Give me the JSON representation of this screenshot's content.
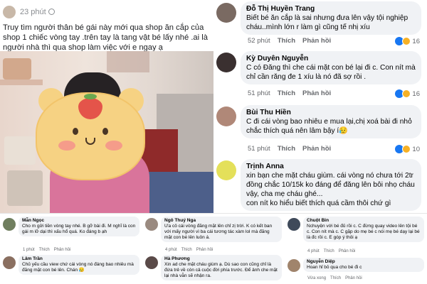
{
  "post": {
    "time": "23 phút",
    "text": "Truy tìm người thân bé gái này mới qua shop ăn cắp của shop 1 chiếc vòng tay .trên tay là tang vật bé lấy nhé .ai là người nhà thì qua shop làm việc với e ngay ạ"
  },
  "labels": {
    "like": "Thích",
    "reply": "Phản hồi"
  },
  "comments": [
    {
      "name": "Đỗ Thị Huyền Trang",
      "text": "Biết bé ăn cắp là sai nhưng đưa lên vậy tội nghiệp cháu..mình lớn r làm gì cũng tế nhị xíu",
      "time": "52 phút",
      "count": "16",
      "avatar": "#7a6a62"
    },
    {
      "name": "Kỳ Duyên Nguyễn",
      "text": "C có Đăng thì che cái mặt con bé lại đi c. Con nít mà chỉ cần răng đe 1 xíu là nó đã sợ rồi .",
      "time": "51 phút",
      "count": "16",
      "avatar": "#3a3030"
    },
    {
      "name": "Bùi Thu Hiền",
      "text": "C đi cái vòng bao nhiêu e mua lại,chị xoá bài đi nhỏ chắc thích quá nên lâm bậy í😥",
      "time": "51 phút",
      "count": "10",
      "avatar": "#b08878"
    },
    {
      "name": "Trịnh Anna",
      "text": "xin bạn che mặt cháu giùm. cái vòng nó chưa tới 2tr đồng chắc 10/15k ko đáng để đăng lên bôi nhọ cháu vậy, cha mẹ cháu ghé...",
      "text2": "con nít ko hiểu biết thích quá cầm thôi chứ gì",
      "avatar": "#e4e05a"
    }
  ],
  "small": [
    {
      "name": "Mẫn Ngọc",
      "text": "Cho m gửi tiền vòng tay nhé. B gỡ bài đi. M nghĩ là con gái m lỡ dại thì xấu hổ quá. Ko đáng b ạh",
      "time": "1 phút"
    },
    {
      "name": "Lâm Trần",
      "text": "Chủ yếu cầu view chứ cái vòng nó đáng bao nhiêu mà đăng mặt con bé lên. Chán 😥",
      "time": ""
    },
    {
      "name": "Ngô Thuý Nga",
      "text": "Ưa cô cái vòng đăng mặt lên chỉ zị trời. K có kết ban với mấy người vì ba cái tương tác xàm lol mà đăng mặt con bé lên luôn á.",
      "time": "4 phút"
    },
    {
      "name": "Hà Phương",
      "text": "Xin ad che mặt cháu giùm ạ. Dù sao con cũng chỉ là đứa trẻ về còn cả cuộc đời phía trước. Để ảnh che mặt lại nhà vẫn sẽ nhận ra.",
      "time": ""
    },
    {
      "name": "Chuột Bin",
      "text": "Nchuyện với bé đủ rồi c. C đừng quay video lên tội bé c. Con nít mà c. C gặp do mẹ bé c nói mẹ bé dạy lại bé là đc rồi c. E góp ý thôi ạ",
      "time": "4 phút"
    },
    {
      "name": "Nguyễn Diệp",
      "text": "Hoan hỉ bỏ qua cho bé đi c",
      "time": "Vừa xong"
    }
  ],
  "colors": {
    "like_blue": "#1877f2",
    "text_gray": "#65676b",
    "bubble": "#f0f2f5"
  }
}
